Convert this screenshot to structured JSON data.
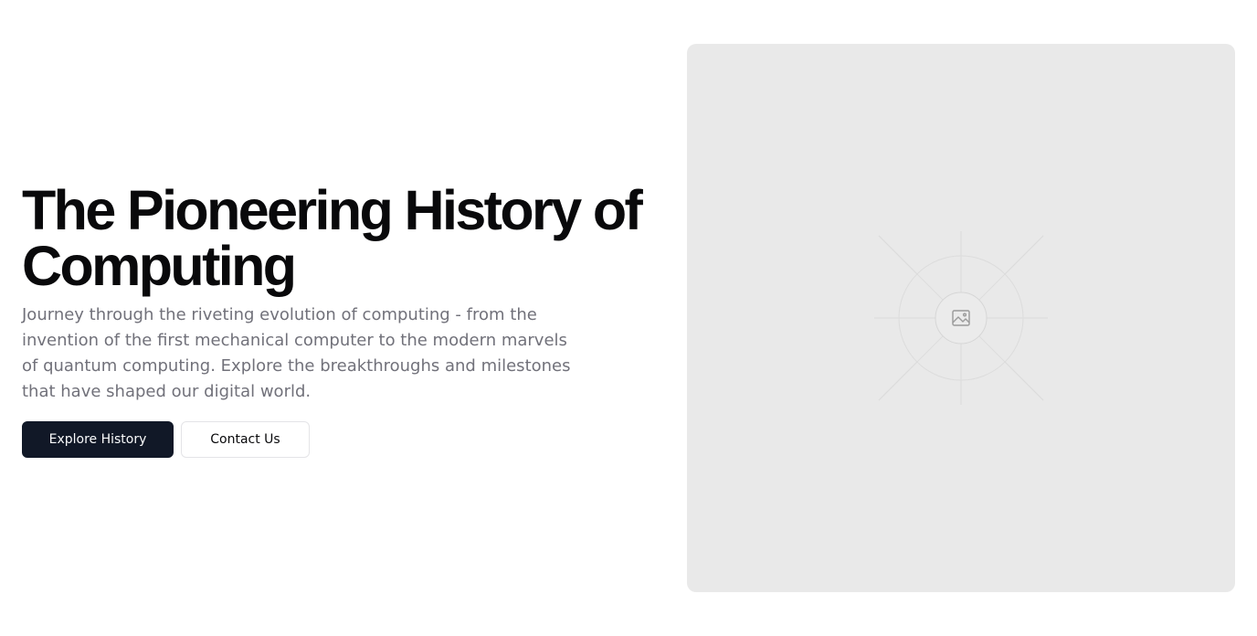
{
  "hero": {
    "title": "The Pioneering History of Computing",
    "description": "Journey through the riveting evolution of computing - from the invention of the first mechanical computer to the modern marvels of quantum computing. Explore the breakthroughs and milestones that have shaped our digital world.",
    "primary_button": "Explore History",
    "secondary_button": "Contact Us"
  },
  "media": {
    "icon": "image-placeholder-icon",
    "background_color": "#e9e9e9"
  },
  "colors": {
    "title": "#09090b",
    "description": "#71717a",
    "primary_button_bg": "#111827",
    "primary_button_text": "#f9fafb",
    "secondary_button_border": "#e4e4e7"
  }
}
